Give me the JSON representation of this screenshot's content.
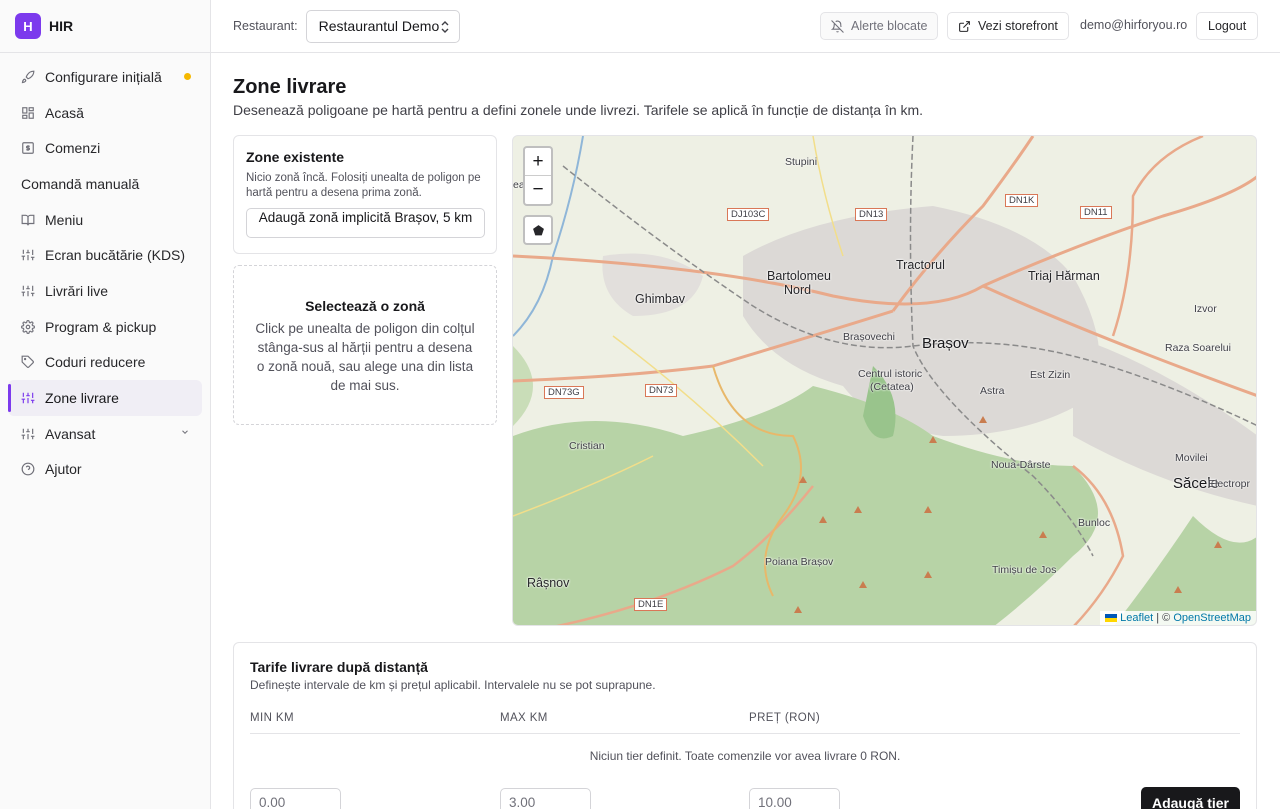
{
  "brand": {
    "logo_letter": "H",
    "name": "HIR",
    "accent": "#7c3aed"
  },
  "sidebar": {
    "items": [
      {
        "label": "Configurare inițială",
        "icon": "rocket-icon"
      },
      {
        "label": "Acasă",
        "icon": "grid-icon"
      },
      {
        "label": "Comenzi",
        "icon": "receipt-icon"
      },
      {
        "label": "Comandă manuală"
      },
      {
        "label": "Meniu",
        "icon": "book-icon"
      },
      {
        "label": "Ecran bucătărie (KDS)",
        "icon": "sliders-icon"
      },
      {
        "label": "Livrări live",
        "icon": "sliders-icon"
      },
      {
        "label": "Program & pickup",
        "icon": "gear-icon"
      },
      {
        "label": "Coduri reducere",
        "icon": "tag-icon"
      },
      {
        "label": "Zone livrare",
        "icon": "sliders-icon"
      },
      {
        "label": "Avansat",
        "icon": "sliders-icon"
      },
      {
        "label": "Ajutor",
        "icon": "help-icon"
      }
    ]
  },
  "header": {
    "restaurant_label": "Restaurant:",
    "restaurant_value": "Restaurantul Demo",
    "alerts_label": "Alerte blocate",
    "storefront_label": "Vezi storefront",
    "email": "demo@hirforyou.ro",
    "logout_label": "Logout"
  },
  "page": {
    "title": "Zone livrare",
    "description": "Desenează poligoane pe hartă pentru a defini zonele unde livrezi. Tarifele se aplică în funcție de distanța în km."
  },
  "zones": {
    "title": "Zone existente",
    "empty_text": "Nicio zonă încă. Folosiți unealta de poligon pe hartă pentru a desena prima zonă.",
    "add_default_label": "Adaugă zonă implicită Brașov, 5 km"
  },
  "select_zone": {
    "title": "Selectează o zonă",
    "text": "Click pe unealta de poligon din colțul stânga-sus al hărții pentru a desena o zonă nouă, sau alege una din lista de mai sus."
  },
  "map": {
    "zoom_in": "+",
    "zoom_out": "−",
    "attribution_leaflet": "Leaflet",
    "attribution_sep": "| ©",
    "attribution_osm": "OpenStreetMap",
    "places": {
      "stupini": "Stupini",
      "tractorul": "Tractorul",
      "bartolomeu": "Bartolomeu",
      "nord": "Nord",
      "triaj": "Triaj Hărman",
      "ghimbav": "Ghimbav",
      "izvor": "Izvor",
      "brasovechi": "Brașovechi",
      "brasov": "Brașov",
      "raza": "Raza Soarelui",
      "centru": "Centrul istoric",
      "cetatea": "(Cetatea)",
      "estzizin": "Est Zizin",
      "astra": "Astra",
      "cristian": "Cristian",
      "noua": "Noua-Dârste",
      "movilei": "Movilei",
      "sacele": "Săcele",
      "electro": "Electropr",
      "bunloc": "Bunloc",
      "poiana": "Poiana Brașov",
      "timisu": "Timișu de Jos",
      "rasnov": "Râșnov",
      "ea": "ea"
    },
    "roads": {
      "dj103c": "DJ103C",
      "dn13": "DN13",
      "dn1k": "DN1K",
      "dn11": "DN11",
      "dn73g": "DN73G",
      "dn73": "DN73",
      "dn1e": "DN1E"
    }
  },
  "tariffs": {
    "title": "Tarife livrare după distanță",
    "subtitle": "Definește intervale de km și prețul aplicabil. Intervalele nu se pot suprapune.",
    "columns": {
      "min": "MIN KM",
      "max": "MAX KM",
      "price": "PREȚ (RON)"
    },
    "empty_text": "Niciun tier definit. Toate comenzile vor avea livrare 0 RON.",
    "min_placeholder": "0.00",
    "max_placeholder": "3.00",
    "price_placeholder": "10.00",
    "add_label": "Adaugă tier"
  }
}
